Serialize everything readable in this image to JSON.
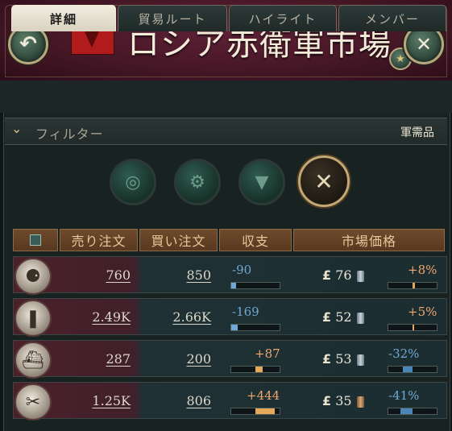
{
  "header": {
    "title": "ロシア赤衛軍市場",
    "back_icon": "↶",
    "close_icon": "✕",
    "search_icon": "⚲",
    "favorite_icon": "★"
  },
  "tabs": [
    {
      "label": "詳細",
      "active": true
    },
    {
      "label": "貿易ルート",
      "active": false
    },
    {
      "label": "ハイライト",
      "active": false
    },
    {
      "label": "メンバー",
      "active": false
    }
  ],
  "filter": {
    "label": "フィルター",
    "chevron": "⌄",
    "category": "軍需品"
  },
  "category_buttons": [
    {
      "name": "barrel-icon",
      "glyph": "◎",
      "active": false
    },
    {
      "name": "gears-icon",
      "glyph": "⚙",
      "active": false
    },
    {
      "name": "gem-icon",
      "glyph": "▼",
      "active": false
    },
    {
      "name": "crossed-rifles-icon",
      "glyph": "✕",
      "active": true
    }
  ],
  "table": {
    "headers": [
      "売り注文",
      "買い注文",
      "収支",
      "市場価格"
    ],
    "currency_symbol": "£",
    "rows": [
      {
        "good": "artillery-icon",
        "glyph": "⚈",
        "sell": "760",
        "buy": "850",
        "balance": "-90",
        "price": "76",
        "change": "+8%",
        "coin": "silver-stack",
        "balance_level": 0.1,
        "change_level": 0.54
      },
      {
        "good": "ammunition-icon",
        "glyph": "❚",
        "sell": "2.49K",
        "buy": "2.66K",
        "balance": "-169",
        "price": "52",
        "change": "+5%",
        "coin": "silver-stack",
        "balance_level": 0.12,
        "change_level": 0.52
      },
      {
        "good": "warship-icon",
        "glyph": "⛴",
        "sell": "287",
        "buy": "200",
        "balance": "+87",
        "price": "53",
        "change": "-32%",
        "coin": "silver",
        "balance_level": 0.15,
        "change_level": 0.3
      },
      {
        "good": "rifle-icon",
        "glyph": "✂",
        "sell": "1.25K",
        "buy": "806",
        "balance": "+444",
        "price": "35",
        "change": "-41%",
        "coin": "gold",
        "balance_level": 0.4,
        "change_level": 0.35
      }
    ]
  },
  "colors": {
    "header": "#461726",
    "table_header": "#6e4a2c",
    "positive": "#f0a66e",
    "negative": "#6fa8d6"
  }
}
